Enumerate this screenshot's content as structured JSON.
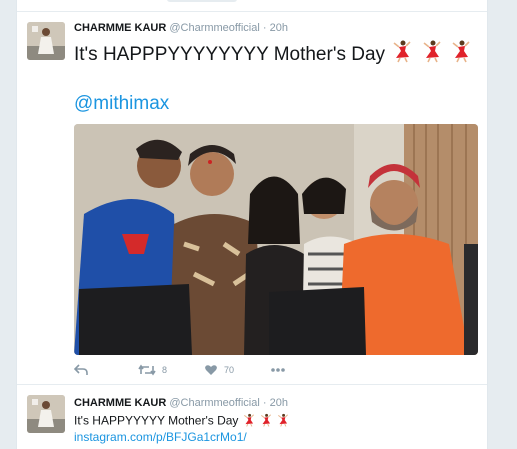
{
  "tweets": [
    {
      "name": "CHARMME KAUR",
      "handle": "@Charmmeofficial",
      "separator": "·",
      "time": "20h",
      "text": "It's HAPPPYYYYYYYY Mother's Day",
      "mention": "@mithimax",
      "emoji_count": 3,
      "actions": {
        "reply_icon": "reply-icon",
        "retweet_icon": "retweet-icon",
        "retweet_count": "8",
        "like_icon": "heart-icon",
        "like_count": "70",
        "more_icon": "more-icon"
      }
    },
    {
      "name": "CHARMME KAUR",
      "handle": "@Charmmeofficial",
      "separator": "·",
      "time": "20h",
      "text": "It's HAPPYYYYY Mother's Day",
      "link": "instagram.com/p/BFJGa1crMo1/",
      "emoji_count": 3
    }
  ],
  "colors": {
    "link": "#1b95e0",
    "meta": "#8899a6",
    "divider": "#e6ecf0"
  }
}
